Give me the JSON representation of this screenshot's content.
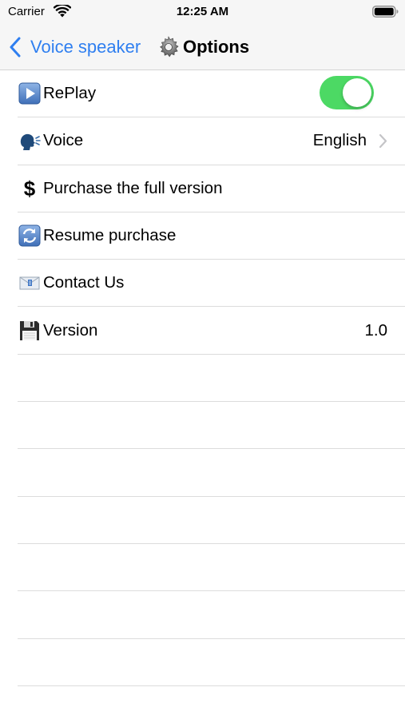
{
  "status_bar": {
    "carrier": "Carrier",
    "time": "12:25 AM"
  },
  "nav": {
    "back_label": "Voice speaker",
    "title": "Options",
    "accent_color": "#2f7ff0"
  },
  "rows": [
    {
      "label": "RePlay",
      "icon": "play-button-icon",
      "control": "toggle",
      "toggle_on": true
    },
    {
      "label": "Voice",
      "icon": "speaking-head-icon",
      "value": "English",
      "disclosure": true
    },
    {
      "label": "Purchase the full version",
      "icon": "dollar-sign-icon"
    },
    {
      "label": "Resume purchase",
      "icon": "refresh-icon"
    },
    {
      "label": "Contact Us",
      "icon": "envelope-icon"
    },
    {
      "label": "Version",
      "icon": "floppy-disk-icon",
      "value": "1.0"
    }
  ],
  "colors": {
    "toggle_on": "#4cd964",
    "bar_background": "#f6f6f6",
    "separator": "#dcdcdc"
  }
}
